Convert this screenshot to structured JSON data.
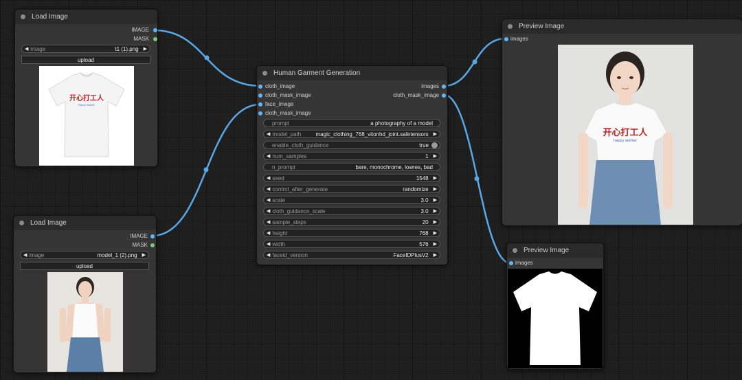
{
  "load_image_1": {
    "title": "Load Image",
    "outputs": [
      "IMAGE",
      "MASK"
    ],
    "image_widget": {
      "name": "image",
      "value": "t1 (1).png"
    },
    "upload_label": "upload",
    "shirt_text": "开心打工人",
    "shirt_subtext": "happy worker"
  },
  "load_image_2": {
    "title": "Load Image",
    "outputs": [
      "IMAGE",
      "MASK"
    ],
    "image_widget": {
      "name": "image",
      "value": "model_1 (2).png"
    },
    "upload_label": "upload"
  },
  "garment_node": {
    "title": "Human Garment Generation",
    "inputs": [
      "cloth_image",
      "cloth_mask_image",
      "face_image",
      "cloth_mask_image"
    ],
    "outputs": [
      "images",
      "cloth_mask_image"
    ],
    "widgets": [
      {
        "name": "prompt",
        "value": "a photography of a model",
        "kind": "text"
      },
      {
        "name": "model_path",
        "value": "magic_clothing_768_vitonhd_joint.safetensors",
        "kind": "combo"
      },
      {
        "name": "enable_cloth_guidance",
        "value": "true",
        "kind": "toggle"
      },
      {
        "name": "num_samples",
        "value": "1",
        "kind": "number"
      },
      {
        "name": "n_prompt",
        "value": "bare, monochrome, lowres, bad",
        "kind": "text"
      },
      {
        "name": "seed",
        "value": "1548",
        "kind": "number"
      },
      {
        "name": "control_after_generate",
        "value": "randomize",
        "kind": "combo"
      },
      {
        "name": "scale",
        "value": "3.0",
        "kind": "number"
      },
      {
        "name": "cloth_guidance_scale",
        "value": "3.0",
        "kind": "number"
      },
      {
        "name": "sample_steps",
        "value": "20",
        "kind": "number"
      },
      {
        "name": "height",
        "value": "768",
        "kind": "number"
      },
      {
        "name": "width",
        "value": "576",
        "kind": "number"
      },
      {
        "name": "faceid_version",
        "value": "FaceIDPlusV2",
        "kind": "combo"
      }
    ]
  },
  "preview_1": {
    "title": "Preview Image",
    "input": "images",
    "shirt_text": "开心打工人",
    "shirt_subtext": "happy worker"
  },
  "preview_2": {
    "title": "Preview Image",
    "input": "images"
  },
  "colors": {
    "image_slot": "#64b5f6",
    "mask_slot": "#81c784",
    "wire": "#5aa8e6",
    "node_body": "#353535",
    "node_title": "#2a2a2a",
    "canvas": "#1f1f1f"
  }
}
